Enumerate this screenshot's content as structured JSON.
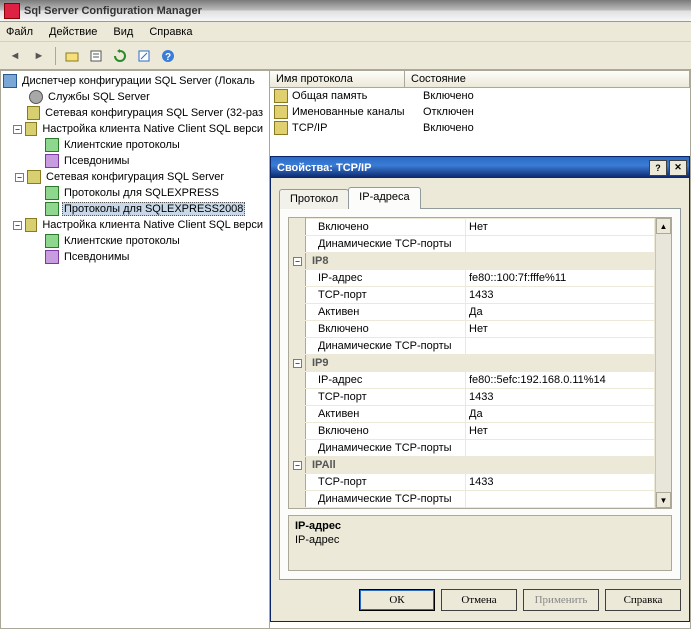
{
  "window": {
    "title": "Sql Server Configuration Manager"
  },
  "menu": {
    "file": "Файл",
    "action": "Действие",
    "view": "Вид",
    "help": "Справка"
  },
  "tree": {
    "root": "Диспетчер конфигурации SQL Server (Локаль",
    "services": "Службы SQL Server",
    "netcfg32": "Сетевая конфигурация SQL Server (32-раз",
    "client_cfg_top": "Настройка клиента Native Client SQL верси",
    "client_protocols": "Клиентские протоколы",
    "aliases": "Псевдонимы",
    "netcfg": "Сетевая конфигурация SQL Server",
    "proto_se": "Протоколы для SQLEXPRESS",
    "proto_se2008": "Протоколы для SQLEXPRESS2008",
    "client_cfg_bot": "Настройка клиента Native Client SQL верси",
    "client_protocols2": "Клиентские протоколы",
    "aliases2": "Псевдонимы"
  },
  "list": {
    "hdr_name": "Имя протокола",
    "hdr_state": "Состояние",
    "rows": [
      {
        "name": "Общая память",
        "state": "Включено"
      },
      {
        "name": "Именованные каналы",
        "state": "Отключен"
      },
      {
        "name": "TCP/IP",
        "state": "Включено"
      }
    ]
  },
  "dialog": {
    "title": "Свойства: TCP/IP",
    "tab_protocol": "Протокол",
    "tab_ip": "IP-адреса",
    "desc_title": "IP-адрес",
    "desc_text": "IP-адрес",
    "btn_ok": "ОК",
    "btn_cancel": "Отмена",
    "btn_apply": "Применить",
    "btn_help": "Справка",
    "labels": {
      "enabled": "Включено",
      "dyn_ports": "Динамические TCP-порты",
      "ip8": "IP8",
      "ip_addr": "IP-адрес",
      "tcp_port": "TCP-порт",
      "active": "Активен",
      "ip9": "IP9",
      "ipall": "IPAll"
    },
    "vals": {
      "no": "Нет",
      "yes": "Да",
      "ip8_addr": "fe80::100:7f:fffe%11",
      "p1433": "1433",
      "ip9_addr": "fe80::5efc:192.168.0.11%14",
      "empty": ""
    }
  }
}
